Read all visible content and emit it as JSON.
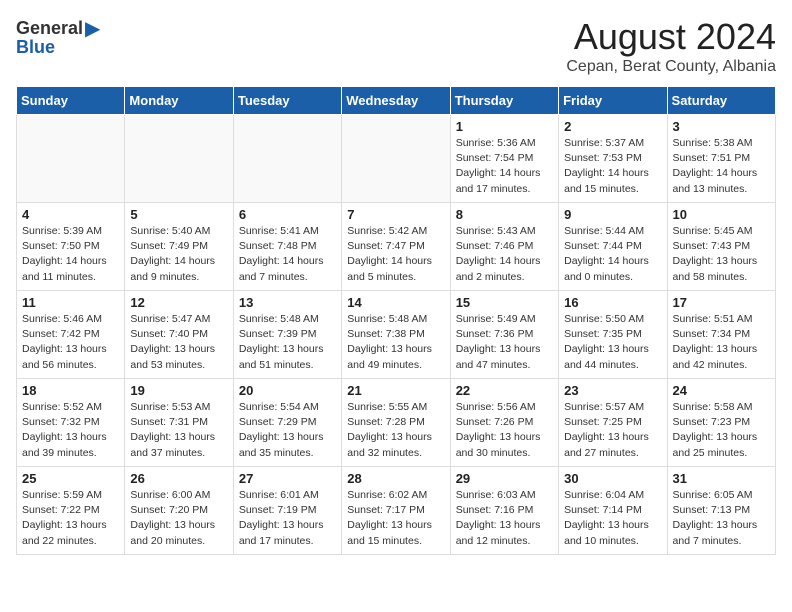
{
  "header": {
    "logo_general": "General",
    "logo_blue": "Blue",
    "month_title": "August 2024",
    "location": "Cepan, Berat County, Albania"
  },
  "weekdays": [
    "Sunday",
    "Monday",
    "Tuesday",
    "Wednesday",
    "Thursday",
    "Friday",
    "Saturday"
  ],
  "weeks": [
    [
      {
        "day": "",
        "info": "",
        "empty": true
      },
      {
        "day": "",
        "info": "",
        "empty": true
      },
      {
        "day": "",
        "info": "",
        "empty": true
      },
      {
        "day": "",
        "info": "",
        "empty": true
      },
      {
        "day": "1",
        "info": "Sunrise: 5:36 AM\nSunset: 7:54 PM\nDaylight: 14 hours\nand 17 minutes.",
        "empty": false
      },
      {
        "day": "2",
        "info": "Sunrise: 5:37 AM\nSunset: 7:53 PM\nDaylight: 14 hours\nand 15 minutes.",
        "empty": false
      },
      {
        "day": "3",
        "info": "Sunrise: 5:38 AM\nSunset: 7:51 PM\nDaylight: 14 hours\nand 13 minutes.",
        "empty": false
      }
    ],
    [
      {
        "day": "4",
        "info": "Sunrise: 5:39 AM\nSunset: 7:50 PM\nDaylight: 14 hours\nand 11 minutes.",
        "empty": false
      },
      {
        "day": "5",
        "info": "Sunrise: 5:40 AM\nSunset: 7:49 PM\nDaylight: 14 hours\nand 9 minutes.",
        "empty": false
      },
      {
        "day": "6",
        "info": "Sunrise: 5:41 AM\nSunset: 7:48 PM\nDaylight: 14 hours\nand 7 minutes.",
        "empty": false
      },
      {
        "day": "7",
        "info": "Sunrise: 5:42 AM\nSunset: 7:47 PM\nDaylight: 14 hours\nand 5 minutes.",
        "empty": false
      },
      {
        "day": "8",
        "info": "Sunrise: 5:43 AM\nSunset: 7:46 PM\nDaylight: 14 hours\nand 2 minutes.",
        "empty": false
      },
      {
        "day": "9",
        "info": "Sunrise: 5:44 AM\nSunset: 7:44 PM\nDaylight: 14 hours\nand 0 minutes.",
        "empty": false
      },
      {
        "day": "10",
        "info": "Sunrise: 5:45 AM\nSunset: 7:43 PM\nDaylight: 13 hours\nand 58 minutes.",
        "empty": false
      }
    ],
    [
      {
        "day": "11",
        "info": "Sunrise: 5:46 AM\nSunset: 7:42 PM\nDaylight: 13 hours\nand 56 minutes.",
        "empty": false
      },
      {
        "day": "12",
        "info": "Sunrise: 5:47 AM\nSunset: 7:40 PM\nDaylight: 13 hours\nand 53 minutes.",
        "empty": false
      },
      {
        "day": "13",
        "info": "Sunrise: 5:48 AM\nSunset: 7:39 PM\nDaylight: 13 hours\nand 51 minutes.",
        "empty": false
      },
      {
        "day": "14",
        "info": "Sunrise: 5:48 AM\nSunset: 7:38 PM\nDaylight: 13 hours\nand 49 minutes.",
        "empty": false
      },
      {
        "day": "15",
        "info": "Sunrise: 5:49 AM\nSunset: 7:36 PM\nDaylight: 13 hours\nand 47 minutes.",
        "empty": false
      },
      {
        "day": "16",
        "info": "Sunrise: 5:50 AM\nSunset: 7:35 PM\nDaylight: 13 hours\nand 44 minutes.",
        "empty": false
      },
      {
        "day": "17",
        "info": "Sunrise: 5:51 AM\nSunset: 7:34 PM\nDaylight: 13 hours\nand 42 minutes.",
        "empty": false
      }
    ],
    [
      {
        "day": "18",
        "info": "Sunrise: 5:52 AM\nSunset: 7:32 PM\nDaylight: 13 hours\nand 39 minutes.",
        "empty": false
      },
      {
        "day": "19",
        "info": "Sunrise: 5:53 AM\nSunset: 7:31 PM\nDaylight: 13 hours\nand 37 minutes.",
        "empty": false
      },
      {
        "day": "20",
        "info": "Sunrise: 5:54 AM\nSunset: 7:29 PM\nDaylight: 13 hours\nand 35 minutes.",
        "empty": false
      },
      {
        "day": "21",
        "info": "Sunrise: 5:55 AM\nSunset: 7:28 PM\nDaylight: 13 hours\nand 32 minutes.",
        "empty": false
      },
      {
        "day": "22",
        "info": "Sunrise: 5:56 AM\nSunset: 7:26 PM\nDaylight: 13 hours\nand 30 minutes.",
        "empty": false
      },
      {
        "day": "23",
        "info": "Sunrise: 5:57 AM\nSunset: 7:25 PM\nDaylight: 13 hours\nand 27 minutes.",
        "empty": false
      },
      {
        "day": "24",
        "info": "Sunrise: 5:58 AM\nSunset: 7:23 PM\nDaylight: 13 hours\nand 25 minutes.",
        "empty": false
      }
    ],
    [
      {
        "day": "25",
        "info": "Sunrise: 5:59 AM\nSunset: 7:22 PM\nDaylight: 13 hours\nand 22 minutes.",
        "empty": false
      },
      {
        "day": "26",
        "info": "Sunrise: 6:00 AM\nSunset: 7:20 PM\nDaylight: 13 hours\nand 20 minutes.",
        "empty": false
      },
      {
        "day": "27",
        "info": "Sunrise: 6:01 AM\nSunset: 7:19 PM\nDaylight: 13 hours\nand 17 minutes.",
        "empty": false
      },
      {
        "day": "28",
        "info": "Sunrise: 6:02 AM\nSunset: 7:17 PM\nDaylight: 13 hours\nand 15 minutes.",
        "empty": false
      },
      {
        "day": "29",
        "info": "Sunrise: 6:03 AM\nSunset: 7:16 PM\nDaylight: 13 hours\nand 12 minutes.",
        "empty": false
      },
      {
        "day": "30",
        "info": "Sunrise: 6:04 AM\nSunset: 7:14 PM\nDaylight: 13 hours\nand 10 minutes.",
        "empty": false
      },
      {
        "day": "31",
        "info": "Sunrise: 6:05 AM\nSunset: 7:13 PM\nDaylight: 13 hours\nand 7 minutes.",
        "empty": false
      }
    ]
  ]
}
